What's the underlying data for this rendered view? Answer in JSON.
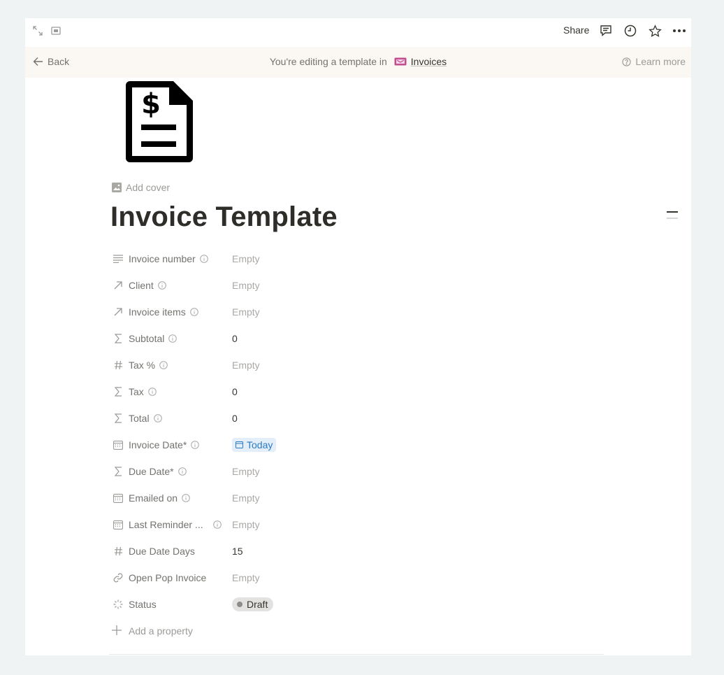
{
  "topbar": {
    "share_label": "Share",
    "icons": [
      "expand-icon",
      "peek-mode-icon",
      "comment-icon",
      "history-icon",
      "star-icon",
      "more-icon"
    ]
  },
  "banner": {
    "back_label": "Back",
    "editing_text": "You're editing a template in",
    "database_name": "Invoices",
    "learn_more_label": "Learn more"
  },
  "page": {
    "add_cover_label": "Add cover",
    "title": "Invoice Template",
    "icon": "invoice-dollar-icon"
  },
  "properties": [
    {
      "name": "Invoice number",
      "icon": "text-icon",
      "value": "Empty"
    },
    {
      "name": "Client",
      "icon": "relation-icon",
      "value": "Empty"
    },
    {
      "name": "Invoice items",
      "icon": "relation-icon",
      "value": "Empty"
    },
    {
      "name": "Subtotal",
      "icon": "formula-icon",
      "value": "0"
    },
    {
      "name": "Tax %",
      "icon": "number-icon",
      "value": "Empty"
    },
    {
      "name": "Tax",
      "icon": "formula-icon",
      "value": "0"
    },
    {
      "name": "Total",
      "icon": "formula-icon",
      "value": "0"
    },
    {
      "name": "Invoice Date*",
      "icon": "calendar-icon",
      "value": "Today"
    },
    {
      "name": "Due Date*",
      "icon": "formula-icon",
      "value": "Empty"
    },
    {
      "name": "Emailed on",
      "icon": "calendar-icon",
      "value": "Empty"
    },
    {
      "name": "Last Reminder ...",
      "icon": "calendar-icon",
      "value": "Empty"
    },
    {
      "name": "Due Date Days",
      "icon": "number-icon",
      "value": "15"
    },
    {
      "name": "Open Pop Invoice",
      "icon": "link-icon",
      "value": "Empty"
    },
    {
      "name": "Status",
      "icon": "status-icon",
      "value": "Draft"
    }
  ],
  "add_property_label": "Add a property",
  "colors": {
    "date_chip_bg": "#e3eef8",
    "date_chip_text": "#2a7bc4",
    "status_chip_bg": "#e3e2e0",
    "banner_bg": "#fbf8f3"
  }
}
